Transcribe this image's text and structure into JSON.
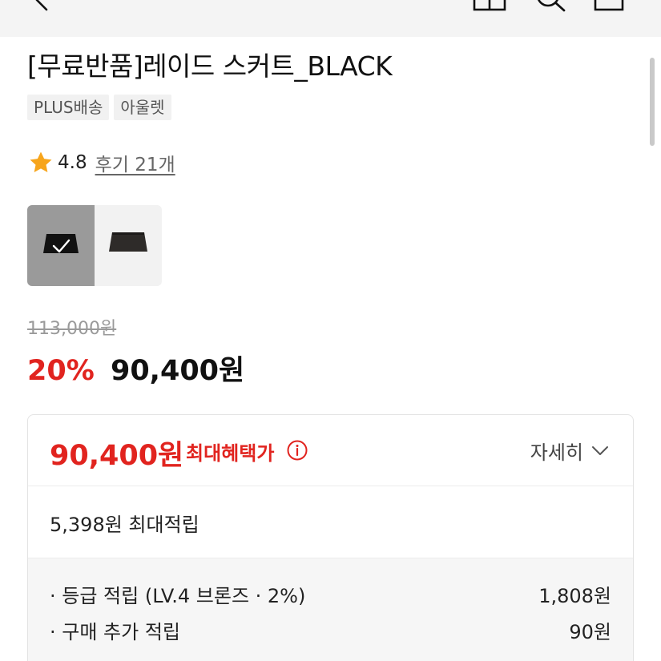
{
  "product": {
    "title": "[무료반품]레이드 스커트_BLACK",
    "tags": [
      "PLUS배송",
      "아울렛"
    ]
  },
  "rating": {
    "score": "4.8",
    "reviews": "후기 21개"
  },
  "price": {
    "original": "113,000원",
    "discount_rate": "20%",
    "final": "90,400원"
  },
  "benefit": {
    "max_price": "90,400원",
    "max_label": "최대혜택가",
    "detail_label": "자세히",
    "max_points": "5,398원 최대적립",
    "items": [
      {
        "name": "· 등급 적립 (LV.4 브론즈 · 2%)",
        "value": "1,808원"
      },
      {
        "name": "· 구매 추가 적립",
        "value": "90원"
      }
    ]
  },
  "colors": {
    "accent_red": "#e1241f",
    "star": "#f7a51c"
  },
  "icons": [
    "back-icon",
    "share-icon",
    "search-icon",
    "cart-icon",
    "star-icon",
    "check-icon",
    "info-icon",
    "chevron-down-icon"
  ]
}
